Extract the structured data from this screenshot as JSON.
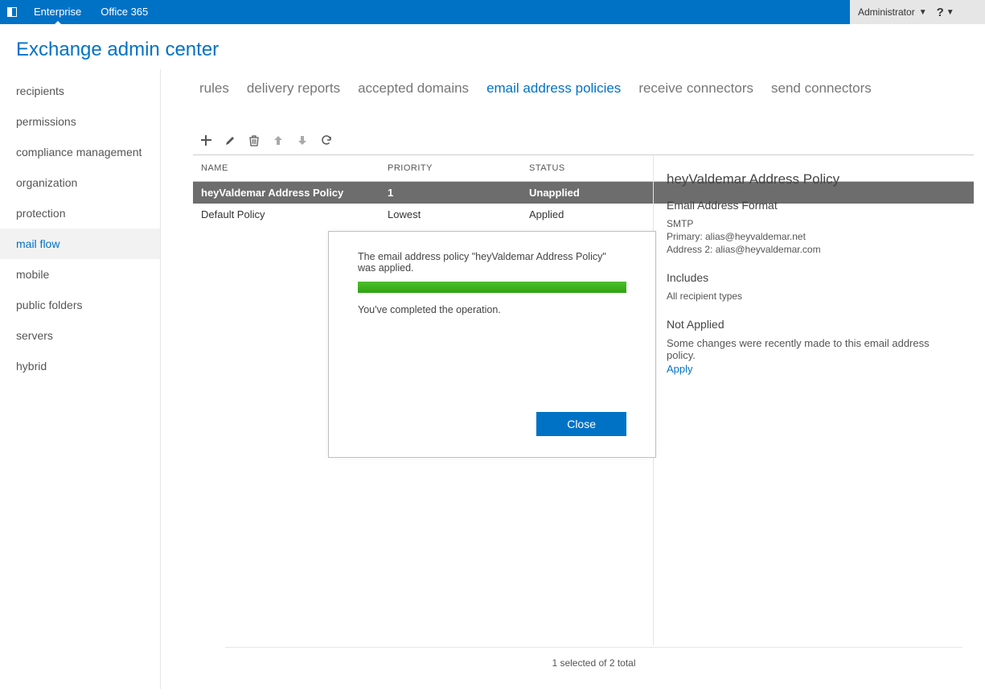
{
  "topbar": {
    "tabs": [
      "Enterprise",
      "Office 365"
    ],
    "active_tab": 0,
    "admin_label": "Administrator",
    "help_label": "?"
  },
  "page_title": "Exchange admin center",
  "sidebar": {
    "items": [
      {
        "label": "recipients"
      },
      {
        "label": "permissions"
      },
      {
        "label": "compliance management"
      },
      {
        "label": "organization"
      },
      {
        "label": "protection"
      },
      {
        "label": "mail flow"
      },
      {
        "label": "mobile"
      },
      {
        "label": "public folders"
      },
      {
        "label": "servers"
      },
      {
        "label": "hybrid"
      }
    ],
    "active_index": 5
  },
  "content_tabs": {
    "items": [
      "rules",
      "delivery reports",
      "accepted domains",
      "email address policies",
      "receive connectors",
      "send connectors"
    ],
    "active_index": 3
  },
  "table": {
    "headers": {
      "name": "NAME",
      "priority": "PRIORITY",
      "status": "STATUS"
    },
    "rows": [
      {
        "name": "heyValdemar Address Policy",
        "priority": "1",
        "status": "Unapplied"
      },
      {
        "name": "Default Policy",
        "priority": "Lowest",
        "status": "Applied"
      }
    ],
    "selected_index": 0
  },
  "details": {
    "title": "heyValdemar Address Policy",
    "format_heading": "Email Address Format",
    "format_lines": [
      "SMTP",
      "Primary: alias@heyvaldemar.net",
      "Address 2: alias@heyvaldemar.com"
    ],
    "includes_heading": "Includes",
    "includes_text": "All recipient types",
    "notapplied_heading": "Not Applied",
    "notapplied_text": "Some changes were recently made to this email address policy.",
    "apply_link": "Apply"
  },
  "footer": {
    "status": "1 selected of 2 total"
  },
  "dialog": {
    "message": "The email address policy \"heyValdemar Address Policy\" was applied.",
    "completion": "You've completed the operation.",
    "close_label": "Close"
  }
}
